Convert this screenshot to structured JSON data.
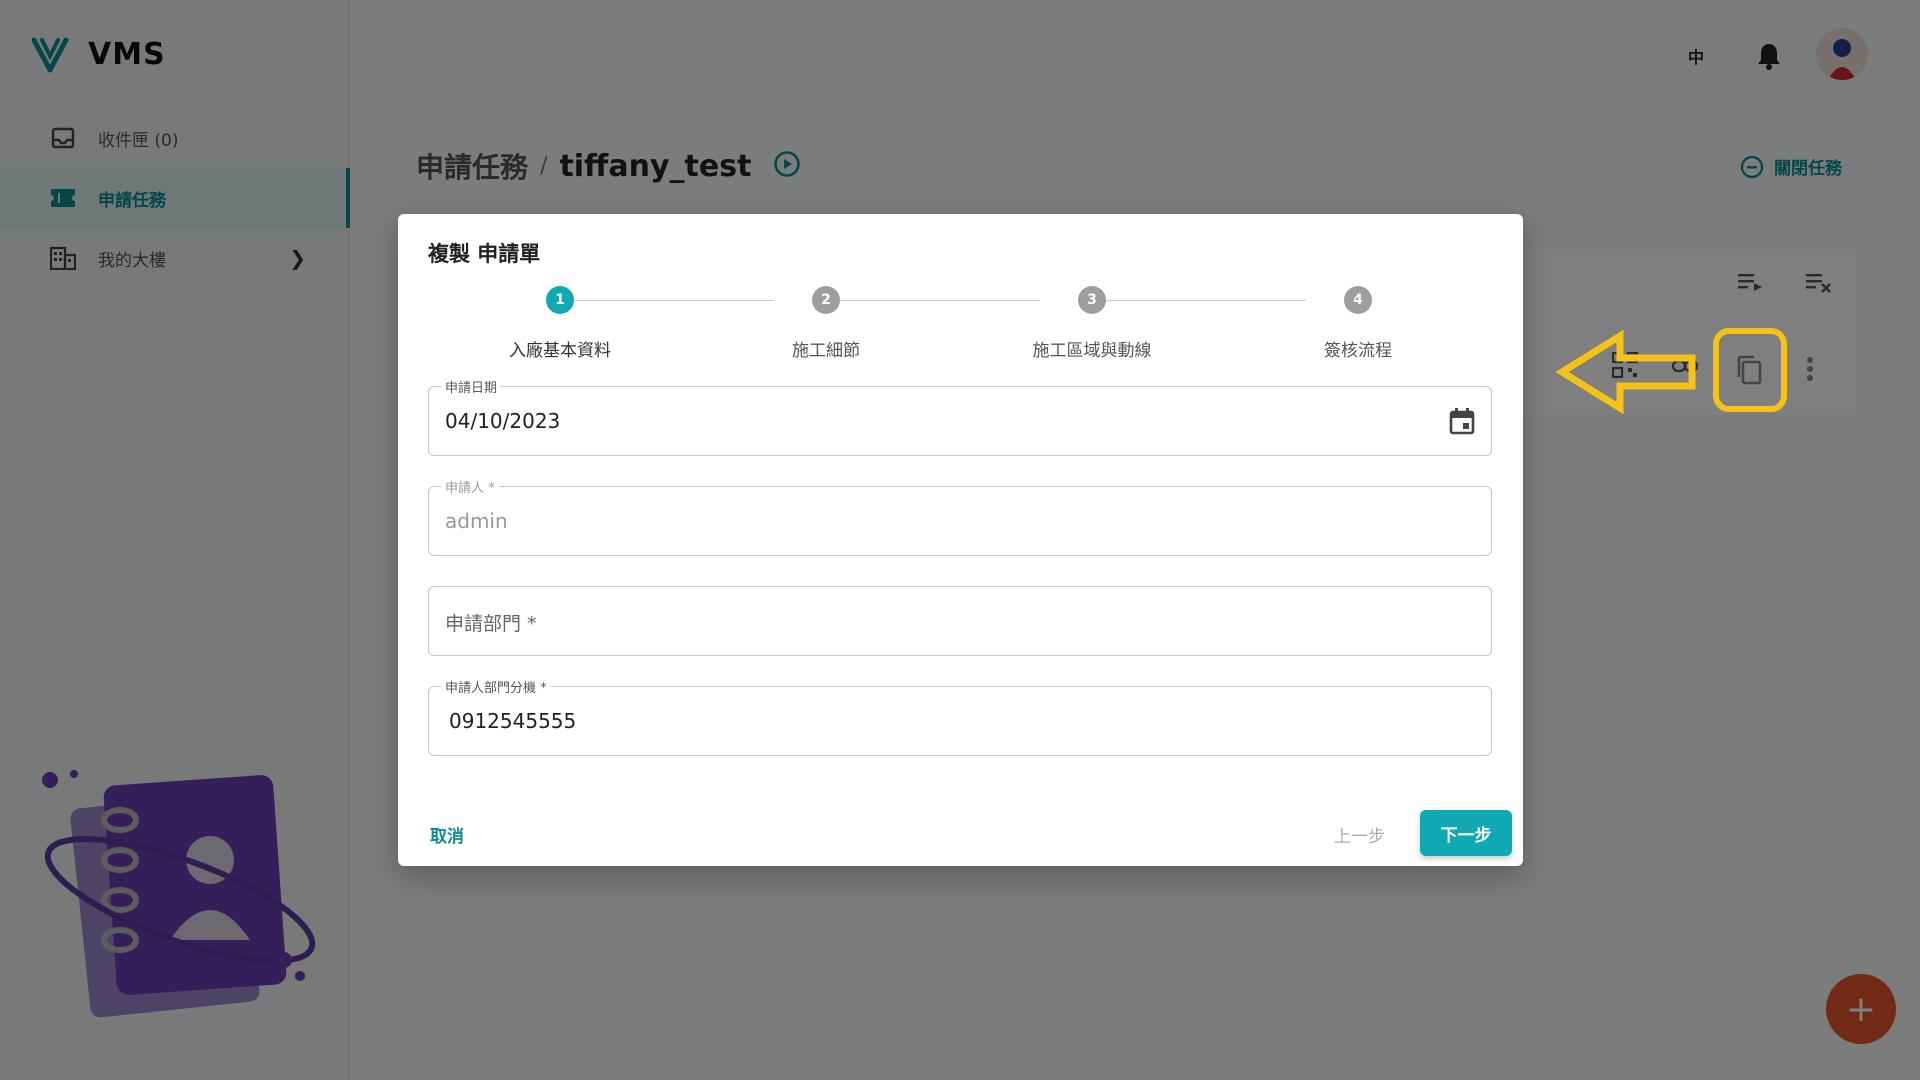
{
  "app": {
    "name": "VMS"
  },
  "sidebar": {
    "items": [
      {
        "label": "收件匣 (0)",
        "icon": "inbox-icon"
      },
      {
        "label": "申請任務",
        "icon": "ticket-icon",
        "active": true
      },
      {
        "label": "我的大樓",
        "icon": "building-icon"
      }
    ]
  },
  "topbar": {
    "language": "中"
  },
  "page": {
    "breadcrumb_root": "申請任務",
    "breadcrumb_sep": "/",
    "breadcrumb_current": "tiffany_test",
    "close_task_label": "關閉任務"
  },
  "modal": {
    "title": "複製 申請單",
    "steps": [
      {
        "num": "1",
        "label": "入廠基本資料",
        "active": true
      },
      {
        "num": "2",
        "label": "施工細節"
      },
      {
        "num": "3",
        "label": "施工區域與動線"
      },
      {
        "num": "4",
        "label": "簽核流程"
      }
    ],
    "fields": {
      "apply_date": {
        "label": "申請日期",
        "value": "04/10/2023"
      },
      "applicant": {
        "label": "申請人 *",
        "value": "admin"
      },
      "department": {
        "placeholder": "申請部門 *"
      },
      "extension": {
        "label": "申請人部門分機 *",
        "value": "0912545555"
      }
    },
    "cancel_label": "取消",
    "prev_label": "上一步",
    "next_label": "下一步"
  },
  "colors": {
    "accent": "#10a9b3",
    "annotation": "#f5c218",
    "fab": "#e2562a"
  }
}
